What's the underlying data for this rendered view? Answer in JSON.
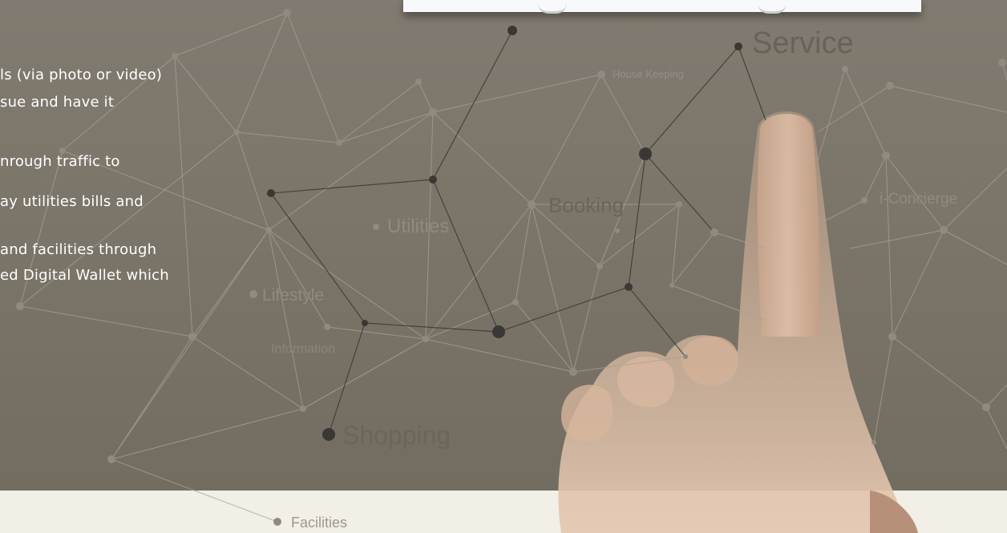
{
  "description_lines": [
    "ls (via photo or video)",
    "sue and have it",
    "nrough traffic to",
    "ay utilities bills and",
    "and facilities through",
    "ed Digital Wallet which"
  ],
  "network_labels": {
    "service": "Service",
    "house_keeping": "House Keeping",
    "booking": "Booking",
    "i_concierge": "i-Concierge",
    "utilities": "Utilities",
    "lifestyle": "Lifestyle",
    "information": "Information",
    "shopping": "Shopping",
    "facilities": "Facilities"
  },
  "colors": {
    "hero_background": "#7a7468",
    "bottom_strip": "#f1efe6",
    "body_text": "#ffffff",
    "node_dark": "#3a3835",
    "node_light": "#8f8a82"
  }
}
